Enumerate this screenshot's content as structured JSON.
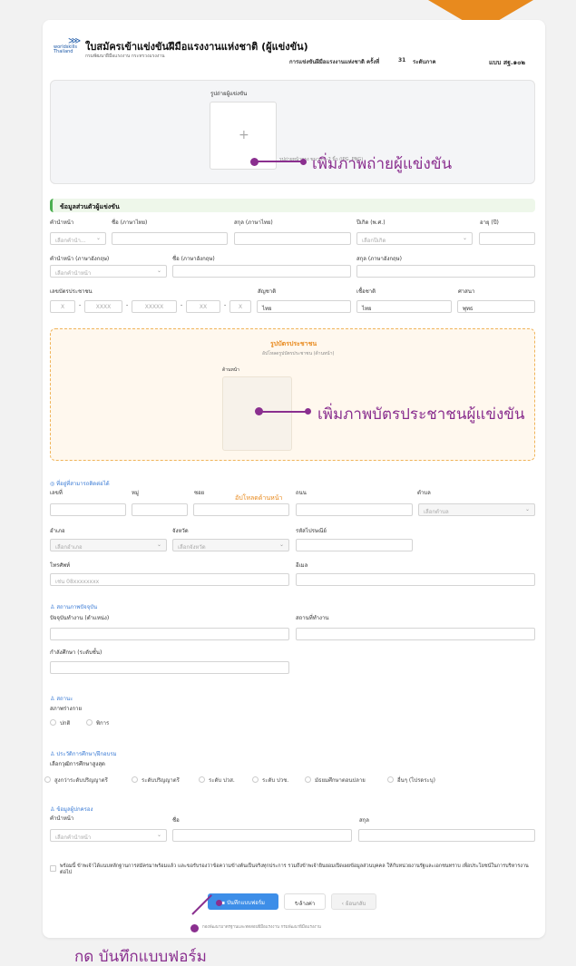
{
  "header": {
    "logo_text": "worldskills Thailand",
    "title": "ใบสมัครเข้าแข่งขันฝีมือแรงงานแห่งชาติ (ผู้แข่งขัน)",
    "org": "กรมพัฒนาฝีมือแรงงาน กระทรวงแรงงาน",
    "competition": "การแข่งขันฝีมือแรงงานแห่งชาติ ครั้งที่",
    "round": "31",
    "level": "ระดับภาค",
    "form_code": "แบบ สฐ.๑๐๒"
  },
  "photo": {
    "label": "รูปถ่ายผู้แข่งขัน",
    "hint": "รูปถ่ายหน้าตรง ขนาด 1-2 นิ้ว (JPG, PNG)",
    "plus": "+"
  },
  "personal": {
    "section_title": "ข้อมูลส่วนตัวผู้แข่งขัน",
    "prefix_label": "คำนำหน้า",
    "name_th_label": "ชื่อ (ภาษาไทย)",
    "surname_th_label": "สกุล (ภาษาไทย)",
    "birth_year_label": "ปีเกิด (พ.ศ.)",
    "age_label": "อายุ (ปี)",
    "prefix_placeholder": "เลือกคำนำ...",
    "birth_year_placeholder": "เลือกปีเกิด",
    "prefix_en_label": "คำนำหน้า (ภาษาอังกฤษ)",
    "name_en_label": "ชื่อ (ภาษาอังกฤษ)",
    "surname_en_label": "สกุล (ภาษาอังกฤษ)",
    "prefix_en_placeholder": "เลือกคำนำหน้า",
    "id_label": "เลขบัตรประชาชน",
    "id_parts": [
      "X",
      "XXXX",
      "XXXXX",
      "XX",
      "X"
    ],
    "dash": "-",
    "nationality_label": "สัญชาติ",
    "nationality_value": "ไทย",
    "race_label": "เชื้อชาติ",
    "race_value": "ไทย",
    "religion_label": "ศาสนา",
    "religion_value": "พุทธ"
  },
  "idcard": {
    "title": "รูปบัตรประชาชน",
    "subtitle": "อัปโหลดรูปบัตรประชาชน (ด้านหน้า)",
    "front_label": "ด้านหน้า"
  },
  "address": {
    "section_title": "ที่อยู่ที่สามารถติดต่อได้",
    "house_no_label": "เลขที่",
    "moo_label": "หมู่",
    "soi_label": "ซอย",
    "upload_front": "อัปโหลดด้านหน้า",
    "road_label": "ถนน",
    "subdistrict_label": "ตำบล",
    "subdistrict_placeholder": "เลือกตำบล",
    "district_label": "อำเภอ",
    "district_placeholder": "เลือกอำเภอ",
    "province_label": "จังหวัด",
    "province_placeholder": "เลือกจังหวัด",
    "postcode_label": "รหัสไปรษณีย์",
    "phone_label": "โทรศัพท์",
    "phone_placeholder": "เช่น 08xxxxxxxx",
    "email_label": "อีเมล"
  },
  "status": {
    "section_title": "สถานภาพปัจจุบัน",
    "job_label": "ปัจจุบันทำงาน (ตำแหน่ง)",
    "workplace_label": "สถานที่ทำงาน",
    "study_label": "กำลังศึกษา (ระดับชั้น)"
  },
  "health": {
    "section_title": "สถานะ",
    "body_label": "สภาพร่างกาย",
    "options": [
      "ปกติ",
      "พิการ"
    ]
  },
  "education": {
    "section_title": "ประวัติการศึกษา/ฝึกอบรม",
    "highest_label": "เลือกวุฒิการศึกษาสูงสุด",
    "options": [
      "สูงกว่าระดับปริญญาตรี",
      "ระดับปริญญาตรี",
      "ระดับ ปวส.",
      "ระดับ ปวช.",
      "มัธยมศึกษาตอนปลาย",
      "อื่นๆ (โปรดระบุ)"
    ]
  },
  "guardian": {
    "section_title": "ข้อมูลผู้ปกครอง",
    "prefix_label": "คำนำหน้า",
    "name_label": "ชื่อ",
    "surname_label": "สกุล",
    "prefix_placeholder": "เลือกคำนำหน้า"
  },
  "consent": {
    "text": "พร้อมนี้ ข้าพเจ้าได้แนบหลักฐานการสมัครมาพร้อมแล้ว และขอรับรองว่าข้อความข้างต้นเป็นจริงทุกประการ รวมถึงข้าพเจ้ายินยอมเปิดเผยข้อมูลส่วนบุคคล ให้กับหน่วยงานรัฐและเอกชนทราบ เพื่อประโยชน์ในการบริหารงานต่อไป"
  },
  "actions": {
    "save": "บันทึกแบบฟอร์ม",
    "clear": "ล้างค่า",
    "back": "ย้อนกลับ",
    "footer": "กองพัฒนามาตรฐานและทดสอบฝีมือแรงงาน กรมพัฒนาฝีมือแรงงาน"
  },
  "annotations": {
    "photo_callout": "เพิ่มภาพถ่ายผู้แข่งขัน",
    "idcard_callout": "เพิ่มภาพบัตรประชาชนผู้แข่งขัน",
    "save_callout": "กด บันทึกแบบฟอร์ม"
  },
  "colors": {
    "accent_orange": "#e88a1e",
    "callout_purple": "#8a2f8f",
    "save_blue": "#3d8ee8",
    "section_green": "#4caf50"
  }
}
